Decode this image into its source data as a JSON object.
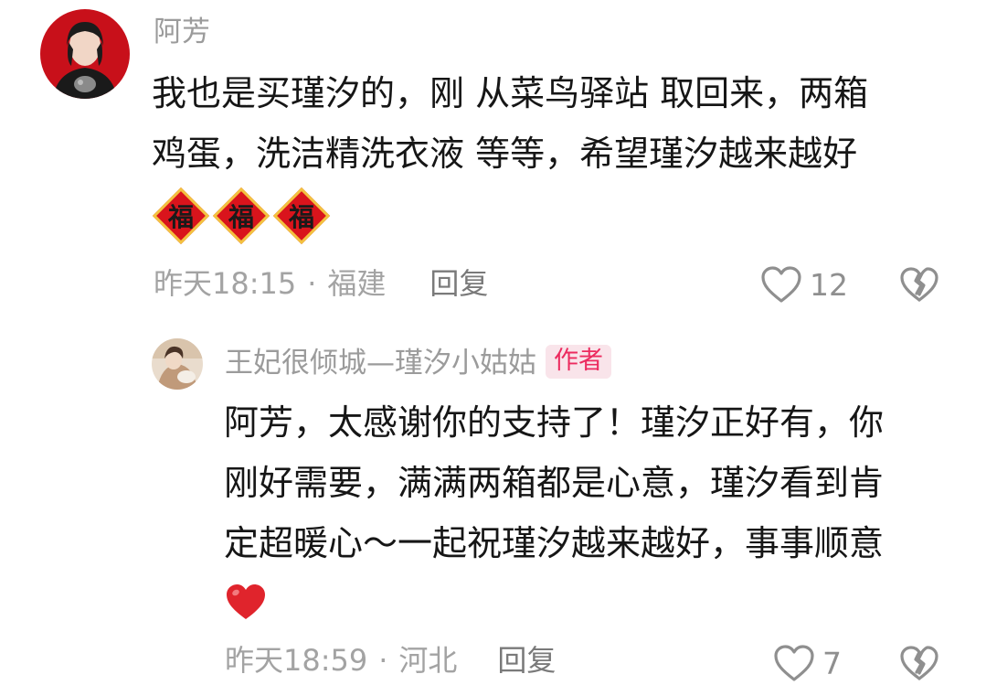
{
  "comments": [
    {
      "username": "阿芳",
      "avatar_icon": "user-avatar-photo",
      "lines": [
        "我也是买瑾汐的，刚 从菜鸟驿站 取回来，两箱",
        "鸡蛋，洗洁精洗衣液 等等，希望瑾汐越来越好"
      ],
      "stickers": [
        "福",
        "福",
        "福"
      ],
      "time": "昨天18:15",
      "separator": "·",
      "location": "福建",
      "reply_label": "回复",
      "like_count": "12"
    }
  ],
  "reply": {
    "username": "王妃很倾城—瑾汐小姑姑",
    "badge": "作者",
    "avatar_icon": "author-avatar-photo",
    "lines": [
      "阿芳，太感谢你的支持了！瑾汐正好有，你",
      "刚好需要，满满两箱都是心意，瑾汐看到肯",
      "定超暖心～一起祝瑾汐越来越好，事事顺意"
    ],
    "emoji": "heart-emoji",
    "time": "昨天18:59",
    "separator": "·",
    "location": "河北",
    "reply_label": "回复",
    "like_count": "7"
  },
  "colors": {
    "secondary_text": "#9b9b9b",
    "badge_text": "#ec2b5f",
    "badge_bg": "#f9e4ea",
    "heart_red": "#e0242c"
  }
}
